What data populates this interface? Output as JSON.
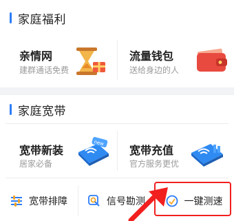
{
  "family_benefits": {
    "title": "家庭福利",
    "cards": [
      {
        "title": "亲情网",
        "subtitle": "建群通话免费",
        "icon": "hourglass-gift-icon"
      },
      {
        "title": "流量钱包",
        "subtitle": "送给身边的人",
        "icon": "red-wallet-icon"
      }
    ]
  },
  "family_broadband": {
    "title": "家庭宽带",
    "cards": [
      {
        "title": "宽带新装",
        "subtitle": "居家必备",
        "icon": "router-new-icon",
        "badge": "new"
      },
      {
        "title": "宽带充值",
        "subtitle": "官方服务更优",
        "icon": "router-topup-icon"
      }
    ],
    "tools": [
      {
        "label": "宽带排障",
        "icon": "sliders-icon"
      },
      {
        "label": "信号勘测",
        "icon": "magnifier-icon"
      },
      {
        "label": "一键测速",
        "icon": "speedometer-icon"
      }
    ]
  },
  "colors": {
    "accent": "#2c7cf6",
    "highlight": "#f21f1f"
  }
}
